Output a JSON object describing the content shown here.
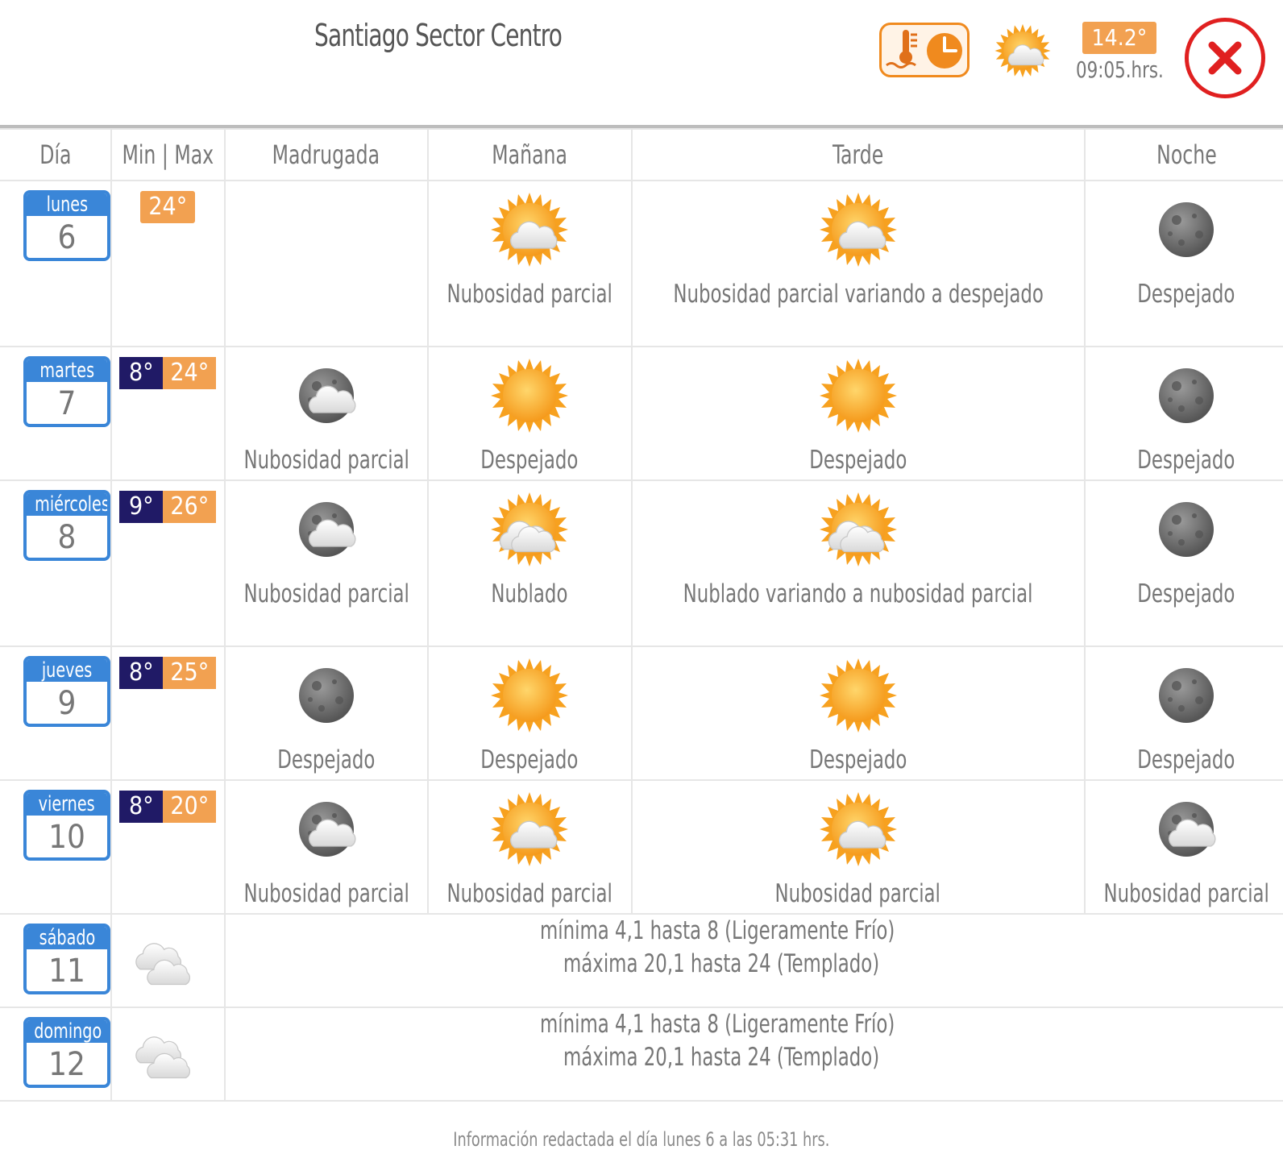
{
  "header": {
    "title": "Santiago Sector Centro",
    "current_temp": "14.2°",
    "current_time": "09:05.hrs."
  },
  "columns": [
    "Día",
    "Min | Max",
    "Madrugada",
    "Mañana",
    "Tarde",
    "Noche"
  ],
  "days": [
    {
      "name": "lunes",
      "num": "6",
      "min": "",
      "max": "24°",
      "periods": [
        {
          "icon": "",
          "text": ""
        },
        {
          "icon": "sun-cloud",
          "text": "Nubosidad parcial"
        },
        {
          "icon": "sun-cloud",
          "text": "Nubosidad parcial variando a despejado"
        },
        {
          "icon": "moon",
          "text": "Despejado"
        }
      ]
    },
    {
      "name": "martes",
      "num": "7",
      "min": "8°",
      "max": "24°",
      "periods": [
        {
          "icon": "moon-cloud",
          "text": "Nubosidad parcial"
        },
        {
          "icon": "sun",
          "text": "Despejado"
        },
        {
          "icon": "sun",
          "text": "Despejado"
        },
        {
          "icon": "moon",
          "text": "Despejado"
        }
      ]
    },
    {
      "name": "miércoles",
      "num": "8",
      "min": "9°",
      "max": "26°",
      "periods": [
        {
          "icon": "moon-cloud",
          "text": "Nubosidad parcial"
        },
        {
          "icon": "sun-clouds",
          "text": "Nublado"
        },
        {
          "icon": "sun-clouds",
          "text": "Nublado variando a nubosidad parcial"
        },
        {
          "icon": "moon",
          "text": "Despejado"
        }
      ]
    },
    {
      "name": "jueves",
      "num": "9",
      "min": "8°",
      "max": "25°",
      "periods": [
        {
          "icon": "moon",
          "text": "Despejado"
        },
        {
          "icon": "sun",
          "text": "Despejado"
        },
        {
          "icon": "sun",
          "text": "Despejado"
        },
        {
          "icon": "moon",
          "text": "Despejado"
        }
      ]
    },
    {
      "name": "viernes",
      "num": "10",
      "min": "8°",
      "max": "20°",
      "periods": [
        {
          "icon": "moon-cloud",
          "text": "Nubosidad parcial"
        },
        {
          "icon": "sun-cloud",
          "text": "Nubosidad parcial"
        },
        {
          "icon": "sun-cloud",
          "text": "Nubosidad parcial"
        },
        {
          "icon": "moon-cloud",
          "text": "Nubosidad parcial"
        }
      ]
    }
  ],
  "extended": [
    {
      "name": "sábado",
      "num": "11",
      "line1": "mínima 4,1 hasta 8 (Ligeramente Frío)",
      "line2": "máxima 20,1 hasta 24 (Templado)"
    },
    {
      "name": "domingo",
      "num": "12",
      "line1": "mínima 4,1 hasta 8 (Ligeramente Frío)",
      "line2": "máxima 20,1 hasta 24 (Templado)"
    }
  ],
  "footer": "Información redactada el día lunes 6 a las 05:31 hrs.",
  "colors": {
    "day_blue": "#3a86d8",
    "min_navy": "#201a66",
    "max_orange": "#f2a151",
    "close_red": "#e02020"
  }
}
